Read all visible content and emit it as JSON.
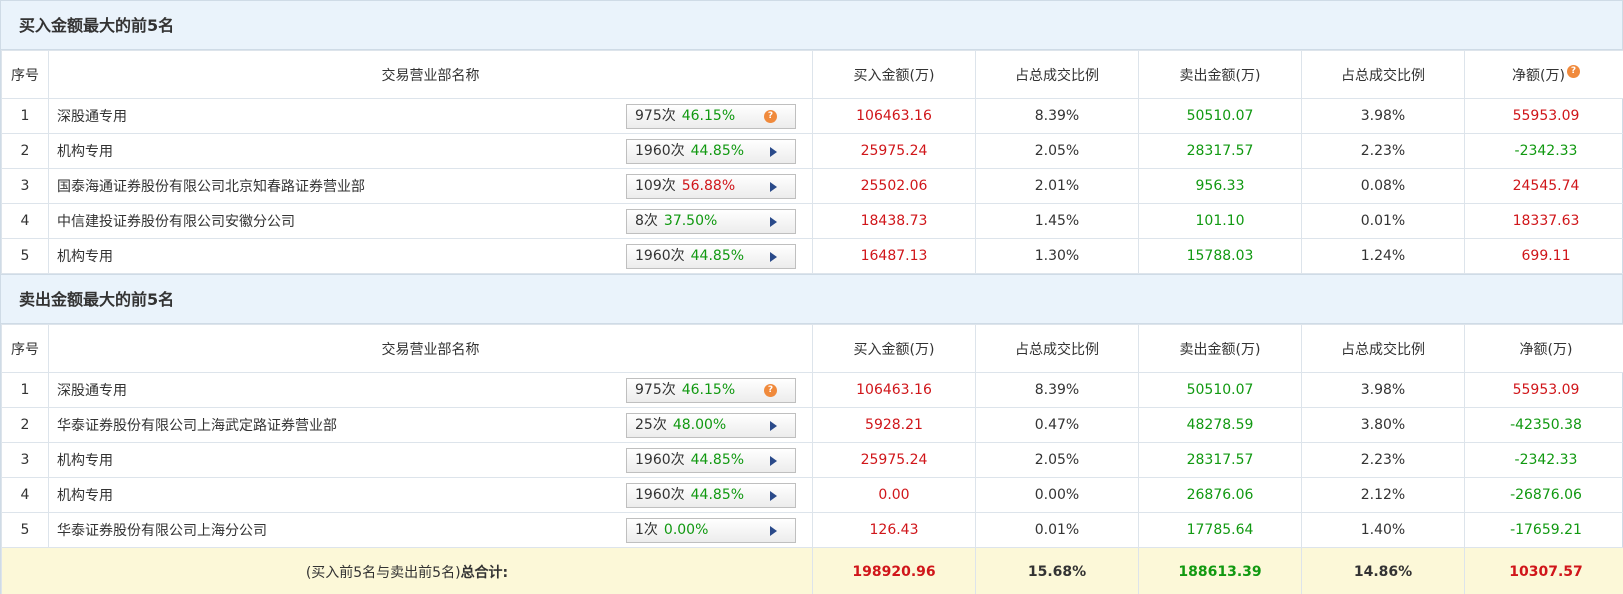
{
  "buy_top": {
    "title": "买入金额最大的前5名",
    "headers": {
      "idx": "序号",
      "name": "交易营业部名称",
      "buy": "买入金额(万)",
      "buy_ratio": "占总成交比例",
      "sell": "卖出金额(万)",
      "sell_ratio": "占总成交比例",
      "net": "净额(万)"
    },
    "rows": [
      {
        "idx": "1",
        "name": "深股通专用",
        "count": "975次",
        "rate": "46.15%",
        "rate_color": "green",
        "icon": "help-icon",
        "buy": "106463.16",
        "buy_ratio": "8.39%",
        "sell": "50510.07",
        "sell_ratio": "3.98%",
        "net": "55953.09",
        "net_color": "red"
      },
      {
        "idx": "2",
        "name": "机构专用",
        "count": "1960次",
        "rate": "44.85%",
        "rate_color": "green",
        "icon": "arrow-icon",
        "buy": "25975.24",
        "buy_ratio": "2.05%",
        "sell": "28317.57",
        "sell_ratio": "2.23%",
        "net": "-2342.33",
        "net_color": "green"
      },
      {
        "idx": "3",
        "name": "国泰海通证券股份有限公司北京知春路证券营业部",
        "count": "109次",
        "rate": "56.88%",
        "rate_color": "red",
        "icon": "arrow-icon",
        "buy": "25502.06",
        "buy_ratio": "2.01%",
        "sell": "956.33",
        "sell_ratio": "0.08%",
        "net": "24545.74",
        "net_color": "red"
      },
      {
        "idx": "4",
        "name": "中信建投证券股份有限公司安徽分公司",
        "count": "8次",
        "rate": "37.50%",
        "rate_color": "green",
        "icon": "arrow-icon",
        "buy": "18438.73",
        "buy_ratio": "1.45%",
        "sell": "101.10",
        "sell_ratio": "0.01%",
        "net": "18337.63",
        "net_color": "red"
      },
      {
        "idx": "5",
        "name": "机构专用",
        "count": "1960次",
        "rate": "44.85%",
        "rate_color": "green",
        "icon": "arrow-icon",
        "buy": "16487.13",
        "buy_ratio": "1.30%",
        "sell": "15788.03",
        "sell_ratio": "1.24%",
        "net": "699.11",
        "net_color": "red"
      }
    ]
  },
  "sell_top": {
    "title": "卖出金额最大的前5名",
    "headers": {
      "idx": "序号",
      "name": "交易营业部名称",
      "buy": "买入金额(万)",
      "buy_ratio": "占总成交比例",
      "sell": "卖出金额(万)",
      "sell_ratio": "占总成交比例",
      "net": "净额(万)"
    },
    "rows": [
      {
        "idx": "1",
        "name": "深股通专用",
        "count": "975次",
        "rate": "46.15%",
        "rate_color": "green",
        "icon": "help-icon",
        "buy": "106463.16",
        "buy_ratio": "8.39%",
        "sell": "50510.07",
        "sell_ratio": "3.98%",
        "net": "55953.09",
        "net_color": "red"
      },
      {
        "idx": "2",
        "name": "华泰证券股份有限公司上海武定路证券营业部",
        "count": "25次",
        "rate": "48.00%",
        "rate_color": "green",
        "icon": "arrow-icon",
        "buy": "5928.21",
        "buy_ratio": "0.47%",
        "sell": "48278.59",
        "sell_ratio": "3.80%",
        "net": "-42350.38",
        "net_color": "green"
      },
      {
        "idx": "3",
        "name": "机构专用",
        "count": "1960次",
        "rate": "44.85%",
        "rate_color": "green",
        "icon": "arrow-icon",
        "buy": "25975.24",
        "buy_ratio": "2.05%",
        "sell": "28317.57",
        "sell_ratio": "2.23%",
        "net": "-2342.33",
        "net_color": "green"
      },
      {
        "idx": "4",
        "name": "机构专用",
        "count": "1960次",
        "rate": "44.85%",
        "rate_color": "green",
        "icon": "arrow-icon",
        "buy": "0.00",
        "buy_ratio": "0.00%",
        "sell": "26876.06",
        "sell_ratio": "2.12%",
        "net": "-26876.06",
        "net_color": "green"
      },
      {
        "idx": "5",
        "name": "华泰证券股份有限公司上海分公司",
        "count": "1次",
        "rate": "0.00%",
        "rate_color": "green",
        "icon": "arrow-icon",
        "buy": "126.43",
        "buy_ratio": "0.01%",
        "sell": "17785.64",
        "sell_ratio": "1.40%",
        "net": "-17659.21",
        "net_color": "green"
      }
    ]
  },
  "total": {
    "label_prefix": "(买入前5名与卖出前5名)",
    "label_suffix": "总合计:",
    "buy": "198920.96",
    "buy_ratio": "15.68%",
    "sell": "188613.39",
    "sell_ratio": "14.86%",
    "net": "10307.57"
  },
  "colors": {
    "red": "#d0161a",
    "green": "#119911",
    "header_bg": "#eaf3fb",
    "total_bg": "#fcf8d8",
    "help_icon": "#f08a3c",
    "arrow_icon": "#2a4a8a"
  },
  "icons": {
    "net_header_help": "help-icon"
  }
}
